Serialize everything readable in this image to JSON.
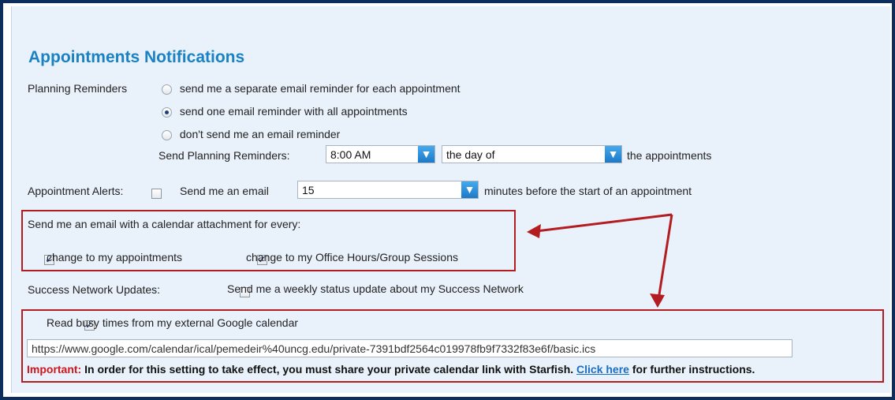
{
  "section_title": "Appointments Notifications",
  "planning": {
    "label": "Planning Reminders",
    "options": [
      {
        "label": "send me a separate email reminder for each appointment",
        "selected": false
      },
      {
        "label": "send one email reminder with all appointments",
        "selected": true
      },
      {
        "label": "don't send me an email reminder",
        "selected": false
      }
    ],
    "send_label": "Send Planning Reminders:",
    "time_value": "8:00 AM",
    "day_value": "the day of",
    "suffix": "the appointments"
  },
  "alerts": {
    "label": "Appointment Alerts:",
    "checked": false,
    "send_text": "Send me an  email",
    "minutes_value": "15",
    "suffix": "minutes before the start of an appointment"
  },
  "calendar_attach": {
    "heading": "Send me an email with a calendar attachment for every:",
    "option1": "change to my appointments",
    "option2": "change to my Office Hours/Group Sessions",
    "option1_checked": true,
    "option2_checked": true
  },
  "success_network": {
    "label": "Success Network Updates:",
    "checked": false,
    "text": "Send me a weekly status update about my Success Network"
  },
  "google": {
    "checked": true,
    "label": "Read busy times from my external Google calendar",
    "url": "https://www.google.com/calendar/ical/pemedeir%40uncg.edu/private-7391bdf2564c019978fb9f7332f83e6f/basic.ics",
    "important_label": "Important:",
    "important_text": " In order for this setting to take effect, you must share your private calendar link with Starfish. ",
    "link_text": "Click here",
    "after_link": " for further instructions."
  },
  "colors": {
    "title": "#1a82c4",
    "highlight_box": "#b31d22",
    "important": "#d0161c",
    "link": "#1a6fc4",
    "dropdown_button": "#2a8ad8"
  },
  "icons": {
    "dropdown": "chevron-down-icon",
    "check": "checkmark-icon"
  }
}
